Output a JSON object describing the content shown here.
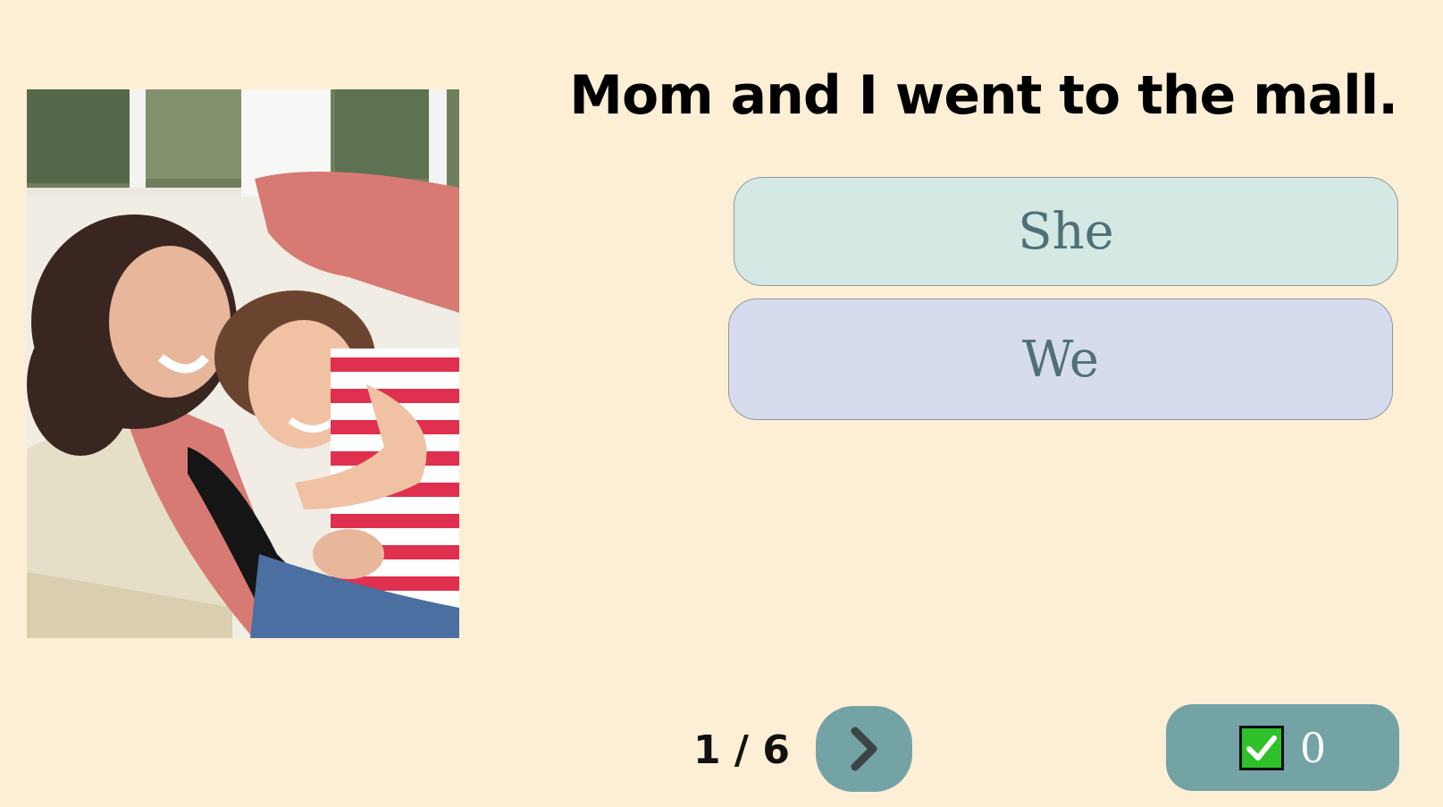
{
  "question": {
    "text": "Mom and I went to the mall."
  },
  "photo": {
    "icon": "mother-daughter-photo"
  },
  "choices": [
    {
      "label": "She",
      "color": "#d4e8e4"
    },
    {
      "label": "We",
      "color": "#d6dbed"
    }
  ],
  "navigation": {
    "pager_text": "1 / 6",
    "next_icon": "chevron-right-icon"
  },
  "score": {
    "icon": "checkmark-icon",
    "value": "0",
    "check_color": "#2ec12a"
  },
  "colors": {
    "background": "#fdefd6",
    "button": "#74a3a6",
    "choice_text": "#4f7076"
  }
}
